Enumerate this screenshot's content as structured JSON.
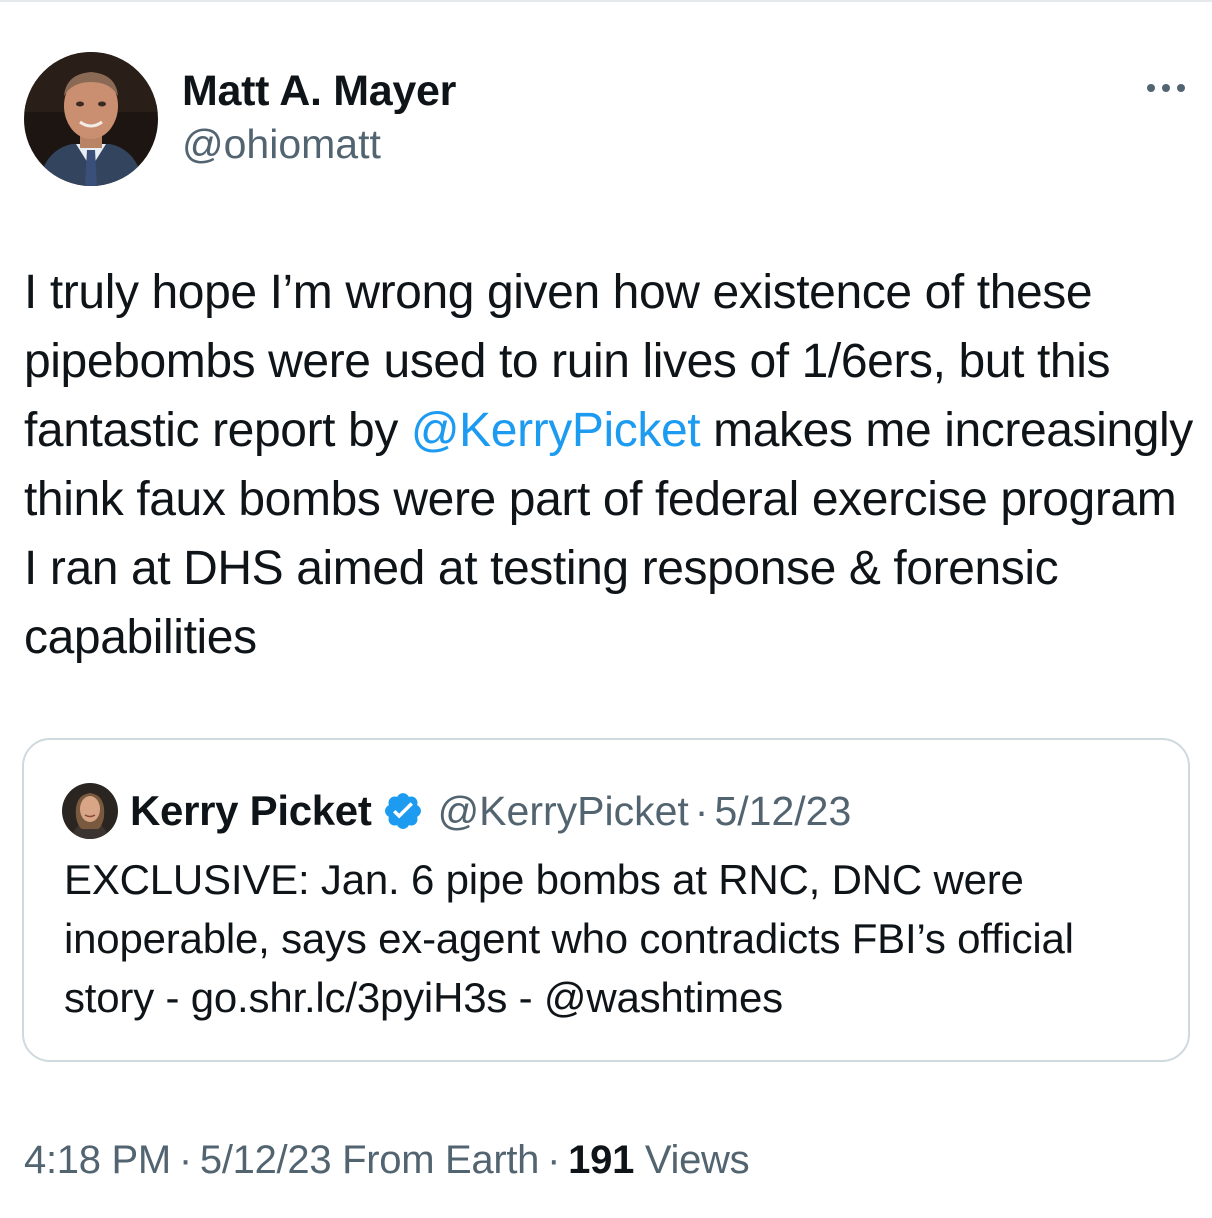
{
  "author": {
    "display_name": "Matt A. Mayer",
    "handle": "@ohiomatt"
  },
  "more_icon": "more-horizontal-icon",
  "tweet": {
    "text_before_mention": "I truly hope I’m wrong given how existence of these pipebombs were used to ruin lives of 1/6ers, but this fantastic report by ",
    "mention": "@KerryPicket",
    "text_after_mention": " makes me increasingly think faux bombs were part of federal exercise program I ran at DHS aimed at testing response & forensic capabilities"
  },
  "quoted_tweet": {
    "display_name": "Kerry Picket",
    "verified_icon": "verified-badge-icon",
    "handle": "@KerryPicket",
    "separator": "·",
    "date": "5/12/23",
    "text": "EXCLUSIVE: Jan. 6 pipe bombs at RNC, DNC were inoperable, says ex-agent who contradicts FBI’s official story - go.shr.lc/3pyiH3s - @washtimes"
  },
  "meta": {
    "time": "4:18 PM",
    "separator": "·",
    "date": "5/12/23",
    "location": "From Earth",
    "views_count": "191",
    "views_label": "Views"
  },
  "colors": {
    "text": "#0f1419",
    "secondary": "#536471",
    "link": "#1d9bf0",
    "border": "#cfd9de"
  }
}
